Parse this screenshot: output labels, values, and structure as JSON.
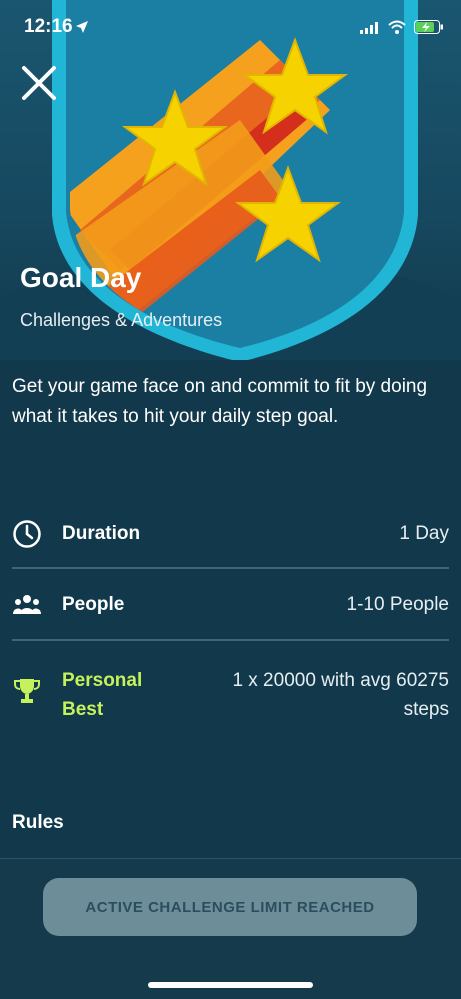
{
  "status_bar": {
    "time": "12:16"
  },
  "hero": {
    "title": "Goal Day",
    "subtitle": "Challenges & Adventures"
  },
  "description": "Get your game face on and commit to fit by doing what it takes to hit your daily step goal.",
  "details": [
    {
      "icon": "clock-icon",
      "label": "Duration",
      "value": "1 Day"
    },
    {
      "icon": "people-icon",
      "label": "People",
      "value": "1-10 People"
    },
    {
      "icon": "trophy-icon",
      "label_line1": "Personal",
      "label_line2": "Best",
      "value_line1": "1 x 20000 with avg 60275",
      "value_line2": "steps",
      "label_color": "#c5f25a"
    }
  ],
  "rules": {
    "label": "Rules"
  },
  "cta": {
    "label": "ACTIVE CHALLENGE LIMIT REACHED",
    "enabled": false
  },
  "colors": {
    "background": "#12394b",
    "accent_green": "#c5f25a",
    "badge_blue": "#1a8fb3",
    "star_yellow": "#f5d200"
  }
}
